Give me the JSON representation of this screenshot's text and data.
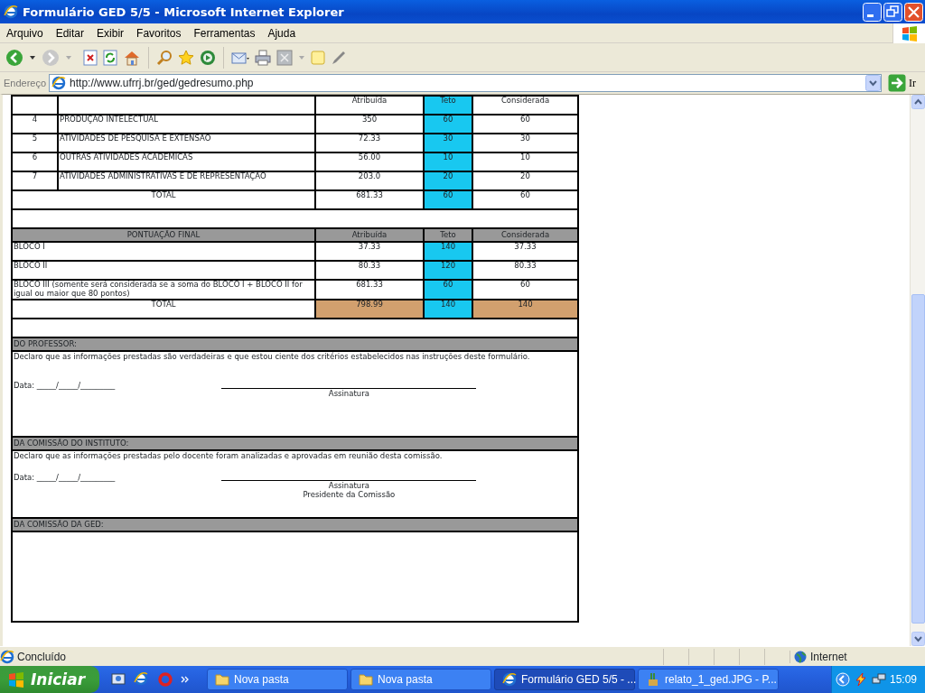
{
  "window": {
    "title": "Formulário GED 5/5 - Microsoft Internet Explorer"
  },
  "menu": [
    "Arquivo",
    "Editar",
    "Exibir",
    "Favoritos",
    "Ferramentas",
    "Ajuda"
  ],
  "address_bar": {
    "label": "Endereço",
    "url": "http://www.ufrrj.br/ged/gedresumo.php",
    "go_label": "Ir"
  },
  "activities_table": {
    "columns": [
      "Atribuída",
      "Teto",
      "Considerada"
    ],
    "rows": [
      {
        "number": "4",
        "description": "PRODUÇÃO INTELECTUAL",
        "attributed": "350",
        "ceiling": "60",
        "considered": "60"
      },
      {
        "number": "5",
        "description": "ATIVIDADES DE PESQUISA E EXTENSÃO",
        "attributed": "72.33",
        "ceiling": "30",
        "considered": "30"
      },
      {
        "number": "6",
        "description": "OUTRAS ATIVIDADES ACADÊMICAS",
        "attributed": "56.00",
        "ceiling": "10",
        "considered": "10"
      },
      {
        "number": "7",
        "description": "ATIVIDADES ADMINISTRATIVAS E DE REPRESENTAÇÃO",
        "attributed": "203.0",
        "ceiling": "20",
        "considered": "20"
      }
    ],
    "total": {
      "label": "TOTAL",
      "attributed": "681.33",
      "ceiling": "60",
      "considered": "60"
    }
  },
  "final_score": {
    "title": "PONTUAÇÃO FINAL",
    "columns": [
      "Atribuída",
      "Teto",
      "Considerada"
    ],
    "rows": [
      {
        "label": "BLOCO I",
        "attributed": "37.33",
        "ceiling": "140",
        "considered": "37.33"
      },
      {
        "label": "BLOCO II",
        "attributed": "80.33",
        "ceiling": "120",
        "considered": "80.33"
      },
      {
        "label": "BLOCO III (somente será considerada se a soma do BLOCO I + BLOCO II for igual ou maior que 80 pontos)",
        "attributed": "681.33",
        "ceiling": "60",
        "considered": "60"
      }
    ],
    "total": {
      "label": "TOTAL",
      "attributed": "798.99",
      "ceiling": "140",
      "considered": "140"
    }
  },
  "sections": [
    {
      "title": "DO PROFESSOR:",
      "statement": "Declaro que as informações prestadas são verdadeiras e que estou ciente dos critérios estabelecidos nas instruções deste formulário.",
      "date_line": "Data: _____/_____/_________",
      "signature_labels": [
        "Assinatura"
      ]
    },
    {
      "title": "DA COMISSÃO DO INSTITUTO:",
      "statement": "Declaro que as informações prestadas pelo docente foram analizadas e aprovadas em reunião desta comissão.",
      "date_line": "Data: _____/_____/_________",
      "signature_labels": [
        "Assinatura",
        "Presidente da Comissão"
      ]
    },
    {
      "title": "DA COMISSÃO DA GED:"
    }
  ],
  "status_bar": {
    "text": "Concluído",
    "zone": "Internet"
  },
  "taskbar": {
    "start": "Iniciar",
    "tasks": [
      {
        "label": "Nova pasta",
        "kind": "folder",
        "selected": false
      },
      {
        "label": "Nova pasta",
        "kind": "folder",
        "selected": false
      },
      {
        "label": "Formulário GED 5/5 - ...",
        "kind": "browser",
        "selected": true
      },
      {
        "label": "relato_1_ged.JPG - P...",
        "kind": "paint",
        "selected": false
      }
    ],
    "clock": "15:09"
  }
}
